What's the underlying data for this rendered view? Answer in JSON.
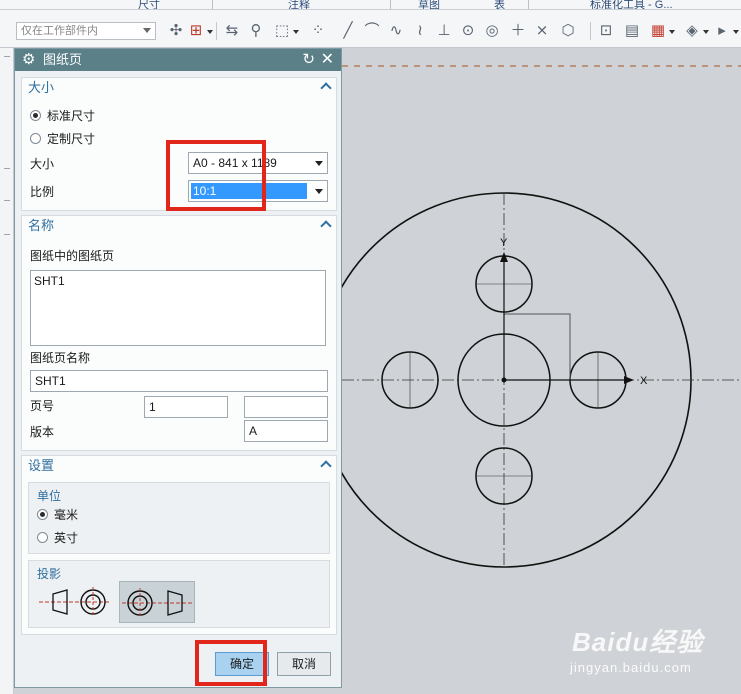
{
  "ribbon": {
    "group_labels": [
      "尺寸",
      "注释",
      "草图",
      "表",
      "标准化工具 - G..."
    ]
  },
  "toolbar": {
    "scope_filter": "仅在工作部件内"
  },
  "dialog": {
    "title": "图纸页",
    "size_section": {
      "title": "大小",
      "option_standard": "标准尺寸",
      "option_custom": "定制尺寸",
      "size_label": "大小",
      "size_value": "A0 - 841 x 1189",
      "scale_label": "比例",
      "scale_value": "10:1"
    },
    "name_section": {
      "title": "名称",
      "sheets_label": "图纸中的图纸页",
      "sheets": [
        "SHT1"
      ],
      "sheet_name_label": "图纸页名称",
      "sheet_name_value": "SHT1",
      "page_number_label": "页号",
      "page_number_value": "1",
      "page_number_extra": "",
      "revision_label": "版本",
      "revision_value": "A"
    },
    "settings_section": {
      "title": "设置",
      "units_title": "单位",
      "unit_mm": "毫米",
      "unit_inch": "英寸",
      "projection_title": "投影"
    },
    "buttons": {
      "ok": "确定",
      "cancel": "取消"
    }
  },
  "canvas": {
    "axis_y": "Y",
    "axis_x": "X"
  },
  "watermark": {
    "main": "Baidu经验",
    "sub": "jingyan.baidu.com"
  },
  "colors": {
    "title_bar": "#5b8088",
    "section_heading": "#2f6f9f",
    "highlight": "#e1261c",
    "canvas_bg": "#cfd2d6"
  }
}
